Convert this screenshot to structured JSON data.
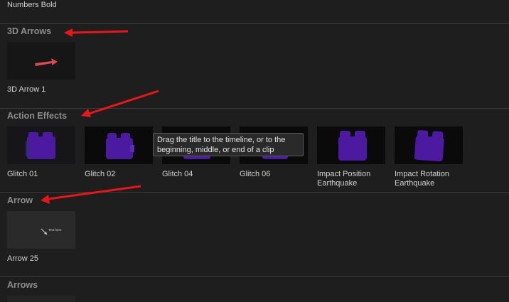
{
  "top_item": {
    "label": "Numbers Bold"
  },
  "sections": [
    {
      "title": "3D Arrows",
      "items": [
        {
          "label": "3D Arrow 1"
        }
      ]
    },
    {
      "title": "Action Effects",
      "items": [
        {
          "label": "Glitch 01"
        },
        {
          "label": "Glitch 02"
        },
        {
          "label": "Glitch 04"
        },
        {
          "label": "Glitch 06"
        },
        {
          "label": "Impact Position Earthquake"
        },
        {
          "label": "Impact Rotation Earthquake"
        }
      ]
    },
    {
      "title": "Arrow",
      "items": [
        {
          "label": "Arrow 25",
          "thumb_text": "Text here"
        }
      ]
    },
    {
      "title": "Arrows",
      "items": []
    }
  ],
  "tooltip": {
    "text": "Drag the title to the timeline, or to the beginning, middle, or end of a clip"
  },
  "colors": {
    "background": "#1e1e1e",
    "section_title": "#8d8d8d",
    "annotation_arrow": "#e8161b",
    "effect_purple": "#4b1aa0"
  }
}
